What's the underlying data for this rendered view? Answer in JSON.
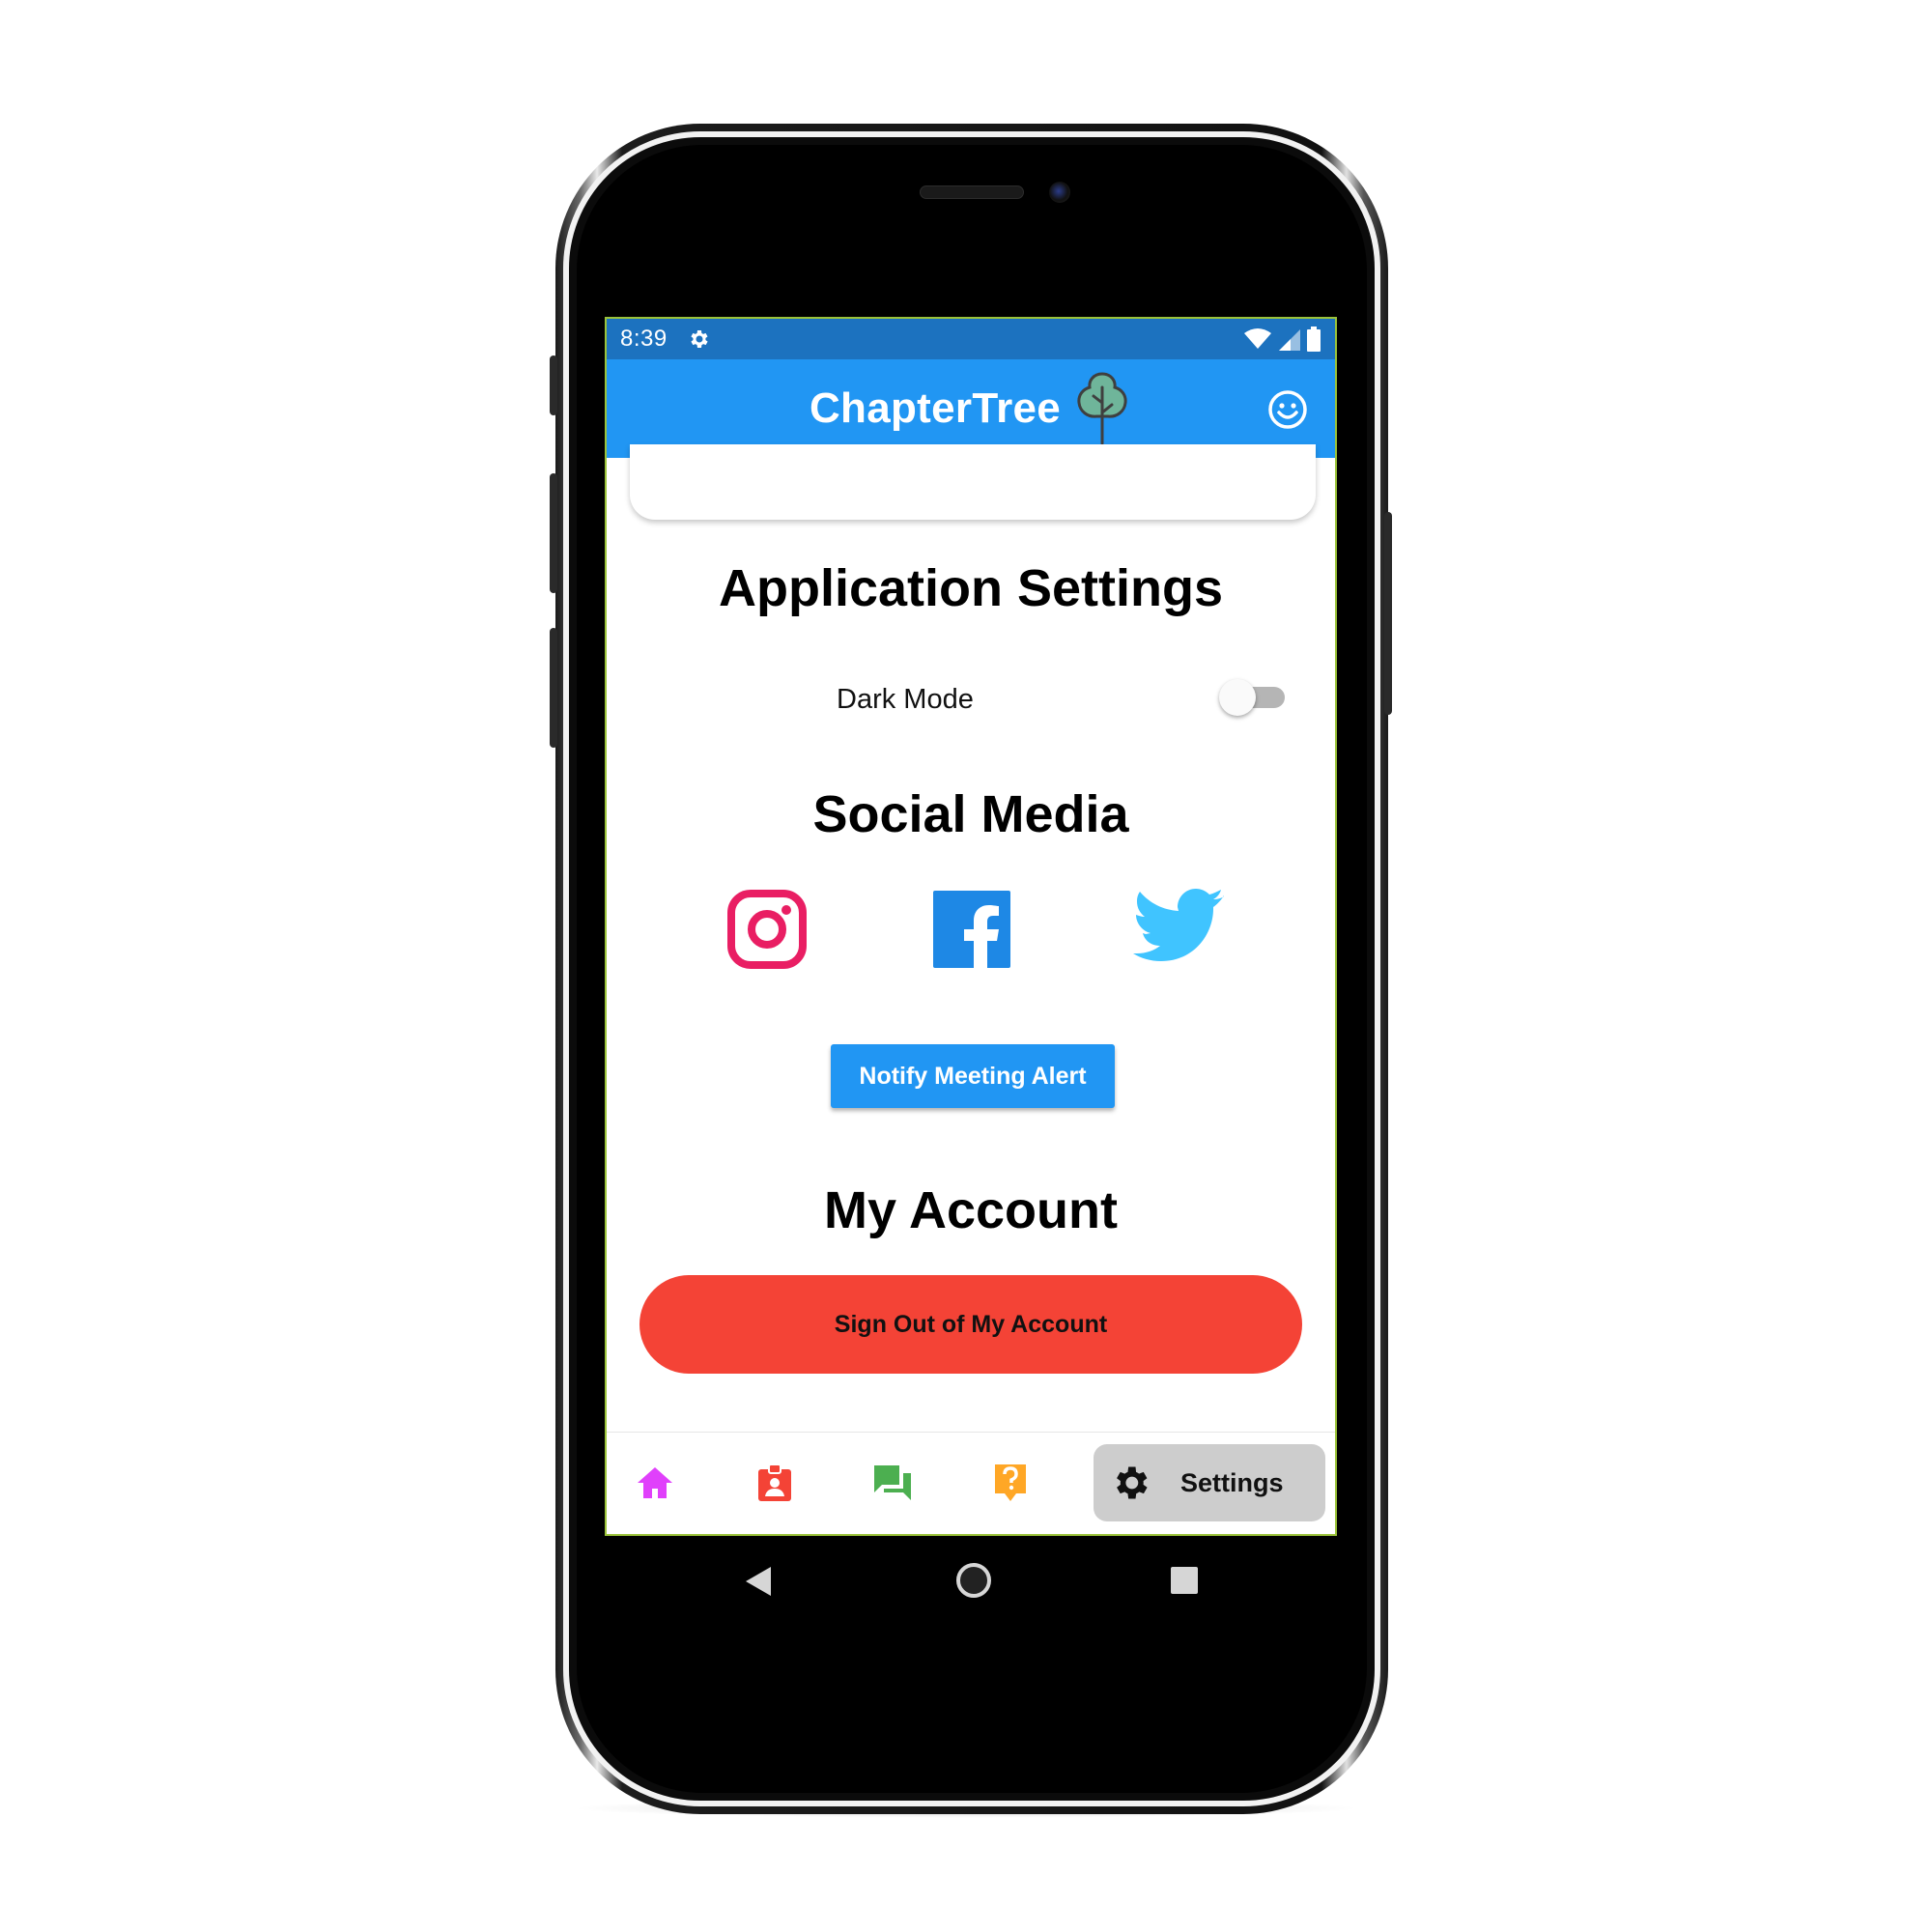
{
  "status_bar": {
    "time": "8:39",
    "icons": [
      "settings-icon",
      "wifi-icon",
      "signal-icon",
      "battery-icon"
    ]
  },
  "app_bar": {
    "title": "ChapterTree",
    "logo_icon": "tree-icon",
    "action_icon": "smiley-face-icon",
    "color": "#2196f3"
  },
  "settings": {
    "section_title": "Application Settings",
    "dark_mode_label": "Dark Mode",
    "dark_mode_enabled": false
  },
  "social": {
    "section_title": "Social Media",
    "links": [
      {
        "name": "Instagram",
        "icon": "instagram-icon",
        "color": "#e91e63"
      },
      {
        "name": "Facebook",
        "icon": "facebook-icon",
        "color": "#1e88e5"
      },
      {
        "name": "Twitter",
        "icon": "twitter-icon",
        "color": "#40c4ff"
      }
    ],
    "notify_button": "Notify Meeting Alert"
  },
  "account": {
    "section_title": "My Account",
    "sign_out_button": "Sign Out of My Account",
    "sign_out_color": "#f44336"
  },
  "bottom_nav": {
    "items": [
      {
        "icon": "home-icon",
        "color": "#e040fb"
      },
      {
        "icon": "contact-badge-icon",
        "color": "#f44336"
      },
      {
        "icon": "chat-icon",
        "color": "#4caf50"
      },
      {
        "icon": "help-icon",
        "color": "#ffa726"
      },
      {
        "icon": "gear-icon",
        "label": "Settings",
        "active": true
      }
    ],
    "active_label": "Settings"
  },
  "system_nav": {
    "icons": [
      "back-icon",
      "home-circle-icon",
      "recents-icon"
    ]
  }
}
